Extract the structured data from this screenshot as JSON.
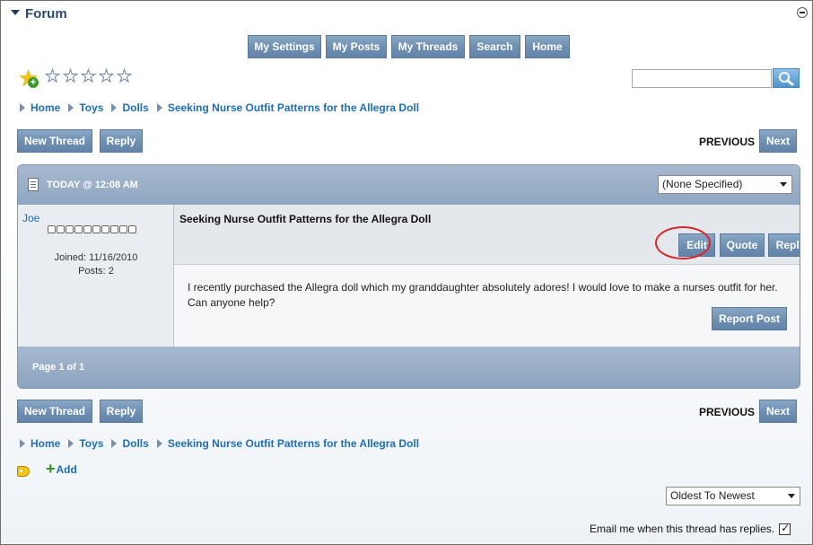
{
  "header": {
    "title": "Forum"
  },
  "nav": {
    "buttons": [
      "My Settings",
      "My Posts",
      "My Threads",
      "Search",
      "Home"
    ]
  },
  "rating": {
    "total_stars": 5,
    "filled": 0
  },
  "search": {
    "value": "",
    "placeholder": ""
  },
  "breadcrumb": [
    "Home",
    "Toys",
    "Dolls",
    "Seeking Nurse Outfit Patterns for the Allegra Doll"
  ],
  "actions": {
    "new_thread": "New Thread",
    "reply": "Reply",
    "previous": "PREVIOUS",
    "next": "Next"
  },
  "post": {
    "date": "TODAY @ 12:08 AM",
    "mood_select": "(None Specified)",
    "author": {
      "name": "Joe",
      "rank_boxes": 10,
      "joined": "Joined: 11/16/2010",
      "posts": "Posts: 2"
    },
    "title": "Seeking Nurse Outfit Patterns for the Allegra Doll",
    "buttons": {
      "edit": "Edit",
      "quote": "Quote",
      "reply": "Reply"
    },
    "body": "I recently purchased the Allegra doll which my granddaughter absolutely adores! I would love to make a nurses outfit for her. Can anyone help?",
    "report": "Report Post"
  },
  "pager": {
    "text": "Page 1 of 1"
  },
  "tags": {
    "add_label": "Add"
  },
  "sort": {
    "selected": "Oldest To Newest"
  },
  "subscribe": {
    "label": "Email me when this thread has replies.",
    "checked": true
  },
  "colors": {
    "button": "#6e8fb2",
    "link": "#1e6fb8",
    "highlight": "#d9262a"
  }
}
